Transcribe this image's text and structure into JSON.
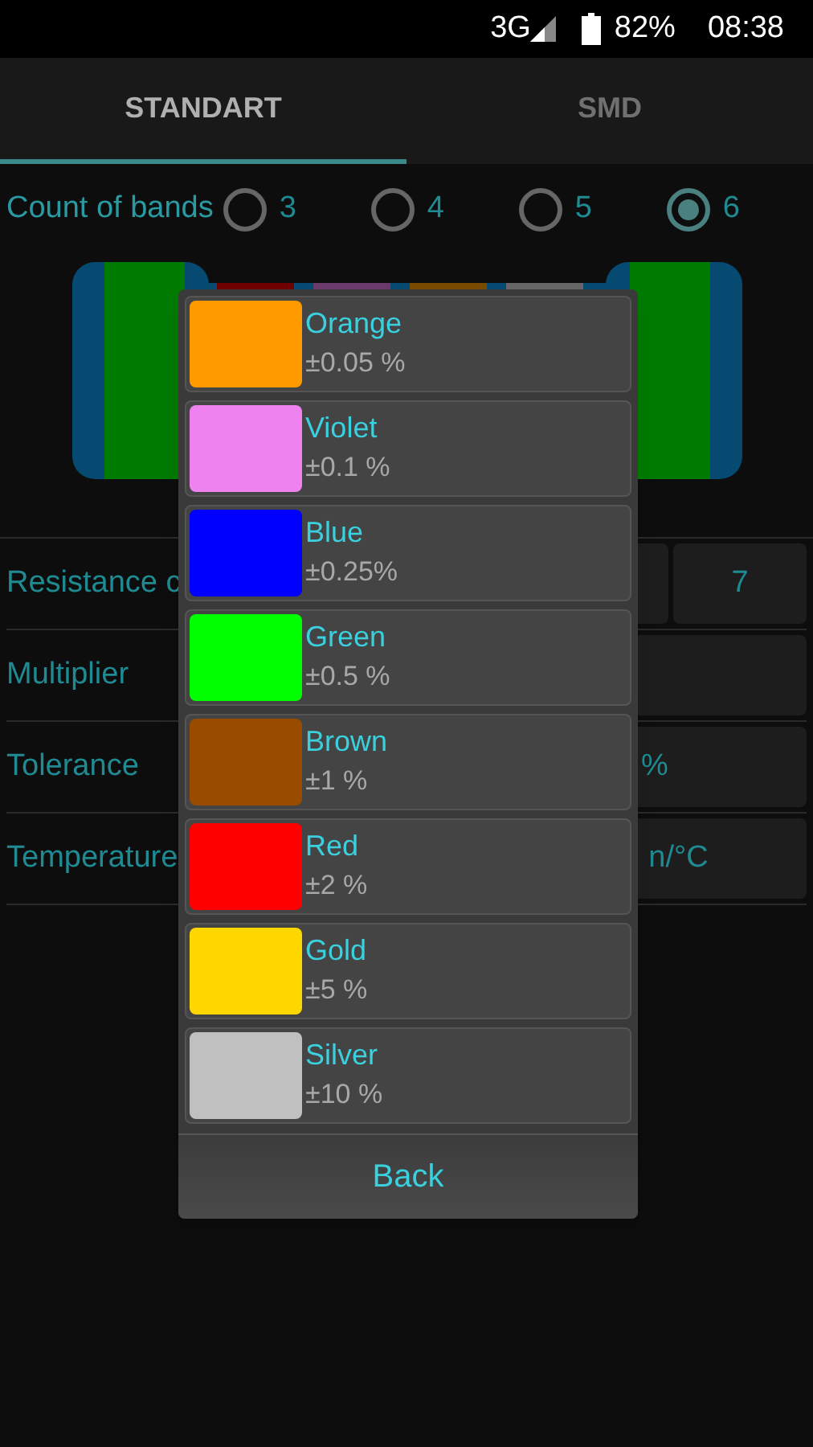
{
  "status_bar": {
    "network": "3G",
    "battery": "82%",
    "time": "08:38"
  },
  "tabs": [
    {
      "label": "STANDART",
      "selected": true
    },
    {
      "label": "SMD",
      "selected": false
    }
  ],
  "band_count": {
    "label": "Count of bands",
    "options": [
      {
        "label": "3",
        "selected": false
      },
      {
        "label": "4",
        "selected": false
      },
      {
        "label": "5",
        "selected": false
      },
      {
        "label": "6",
        "selected": true
      }
    ]
  },
  "resistor": {
    "bands": [
      {
        "color": "#007a00"
      },
      {
        "color": "#6e0000"
      },
      {
        "color": "#6a3a6a"
      },
      {
        "color": "#7a4a00"
      },
      {
        "color": "#666666"
      },
      {
        "color": "#007a00"
      }
    ]
  },
  "rows": [
    {
      "label": "Resistance c",
      "kind": "digits",
      "value": "7"
    },
    {
      "label": "Multiplier",
      "kind": "plain"
    },
    {
      "label": "Tolerance",
      "kind": "plain",
      "value": "%"
    },
    {
      "label": "Temperature",
      "kind": "plain",
      "value": "n/°C"
    }
  ],
  "dialog": {
    "items": [
      {
        "name": "Orange",
        "tolerance": "±0.05 %",
        "color": "#ff9900"
      },
      {
        "name": "Violet",
        "tolerance": "±0.1 %",
        "color": "#ee82ee"
      },
      {
        "name": "Blue",
        "tolerance": "±0.25%",
        "color": "#0000ff"
      },
      {
        "name": "Green",
        "tolerance": "±0.5 %",
        "color": "#00ff00"
      },
      {
        "name": "Brown",
        "tolerance": "±1 %",
        "color": "#994c00"
      },
      {
        "name": "Red",
        "tolerance": "±2 %",
        "color": "#ff0000"
      },
      {
        "name": "Gold",
        "tolerance": "±5 %",
        "color": "#ffd700"
      },
      {
        "name": "Silver",
        "tolerance": "±10 %",
        "color": "#c0c0c0"
      }
    ],
    "button": "Back"
  }
}
